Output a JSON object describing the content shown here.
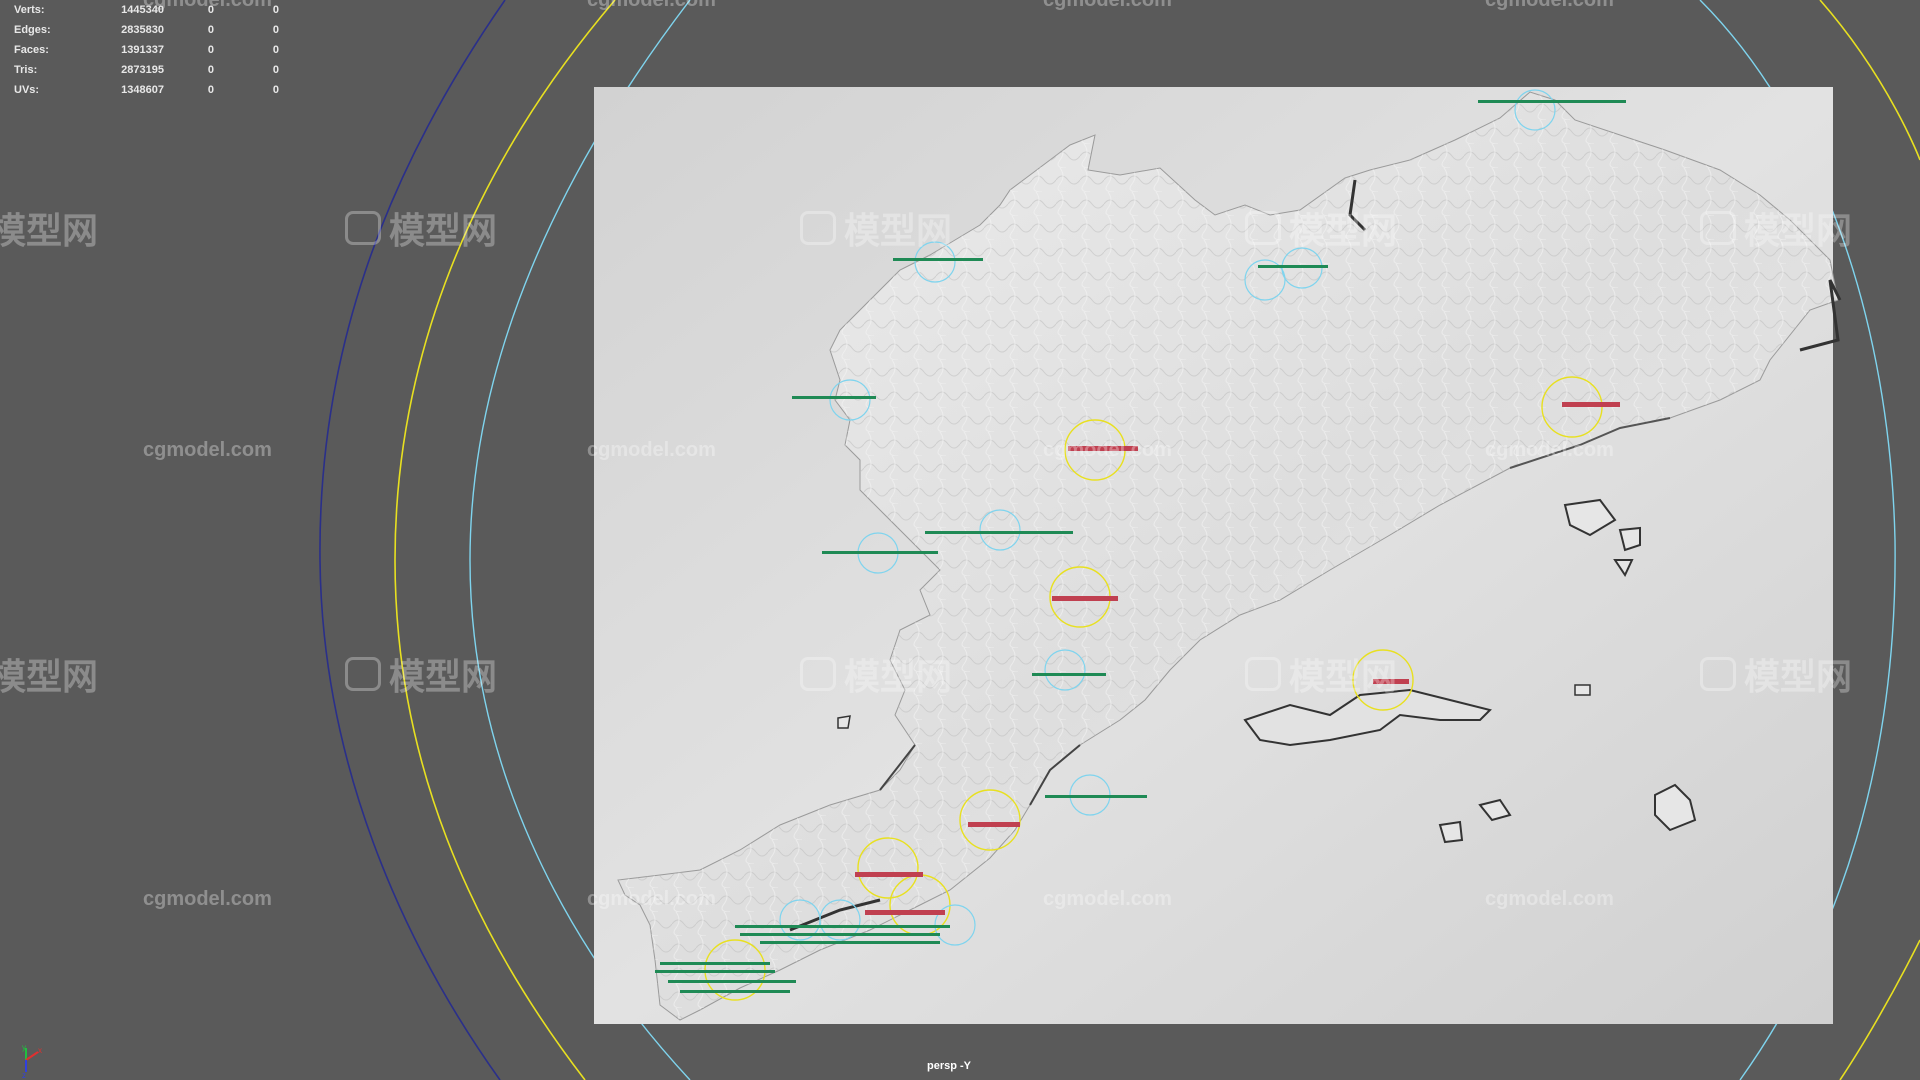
{
  "stats": {
    "rows": [
      {
        "label": "Verts:",
        "total": "1445340",
        "selected": "0",
        "component": "0"
      },
      {
        "label": "Edges:",
        "total": "2835830",
        "selected": "0",
        "component": "0"
      },
      {
        "label": "Faces:",
        "total": "1391337",
        "selected": "0",
        "component": "0"
      },
      {
        "label": "Tris:",
        "total": "2873195",
        "selected": "0",
        "component": "0"
      },
      {
        "label": "UVs:",
        "total": "1348607",
        "selected": "0",
        "component": "0"
      }
    ]
  },
  "camera_label": "persp -Y",
  "watermark": {
    "url_text": "cgmodel.com",
    "cn_text": "模型网"
  },
  "colors": {
    "viewport_bg": "#5a5a5a",
    "model_plane": "#d6d6d6",
    "locator_yellow": "#e8e020",
    "locator_cyan": "#7fd4ee",
    "curve_navy": "#2a2f8a",
    "label_green": "#1f8a55",
    "label_red": "#c04050"
  },
  "axis_gizmo": {
    "x_label": "x",
    "y_label": "y",
    "z_label": "z"
  }
}
